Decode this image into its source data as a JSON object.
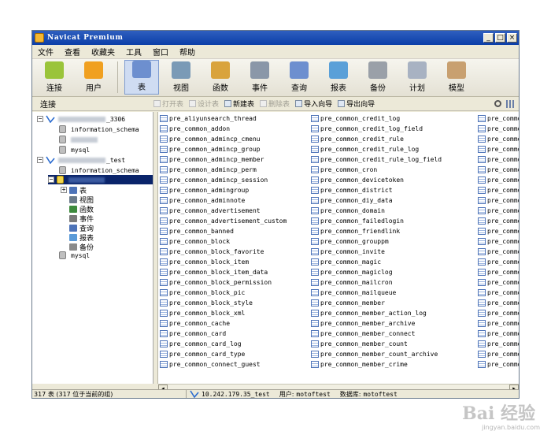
{
  "window": {
    "title": "Navicat Premium",
    "min": "_",
    "max": "□",
    "close": "×"
  },
  "menu": [
    "文件",
    "查看",
    "收藏夹",
    "工具",
    "窗口",
    "帮助"
  ],
  "toolbar": [
    {
      "label": "连接",
      "icon": "plug-icon",
      "color": "#9ac43a"
    },
    {
      "label": "用户",
      "icon": "user-icon",
      "color": "#f0a020"
    },
    {
      "label": "表",
      "icon": "table-icon",
      "color": "#6d8fcf",
      "active": true
    },
    {
      "label": "视图",
      "icon": "view-icon",
      "color": "#7a9ab6"
    },
    {
      "label": "函数",
      "icon": "function-icon",
      "color": "#d9a33c"
    },
    {
      "label": "事件",
      "icon": "event-icon",
      "color": "#8a97a8"
    },
    {
      "label": "查询",
      "icon": "query-icon",
      "color": "#6d8fcf"
    },
    {
      "label": "报表",
      "icon": "report-icon",
      "color": "#5aa0d8"
    },
    {
      "label": "备份",
      "icon": "backup-icon",
      "color": "#9aa0a8"
    },
    {
      "label": "计划",
      "icon": "schedule-icon",
      "color": "#a8b2c2"
    },
    {
      "label": "模型",
      "icon": "model-icon",
      "color": "#c8a070"
    }
  ],
  "subbar": {
    "connection_header": "连接",
    "buttons": [
      {
        "label": "打开表",
        "enabled": false
      },
      {
        "label": "设计表",
        "enabled": false
      },
      {
        "label": "新建表",
        "enabled": true
      },
      {
        "label": "删除表",
        "enabled": false
      },
      {
        "label": "导入向导",
        "enabled": true
      },
      {
        "label": "导出向导",
        "enabled": true
      }
    ]
  },
  "tree": {
    "conn1_suffix": "_3306",
    "conn1_dbs": [
      "information_schema",
      "mysql"
    ],
    "conn2_suffix": "_test",
    "conn2_db": "information_schema",
    "nodes": [
      {
        "label": "表",
        "icon": "tables-node-icon"
      },
      {
        "label": "视图",
        "icon": "views-node-icon"
      },
      {
        "label": "函数",
        "icon": "functions-node-icon"
      },
      {
        "label": "事件",
        "icon": "events-node-icon"
      },
      {
        "label": "查询",
        "icon": "queries-node-icon"
      },
      {
        "label": "报表",
        "icon": "reports-node-icon"
      },
      {
        "label": "备份",
        "icon": "backups-node-icon"
      }
    ],
    "conn2_last_db": "mysql"
  },
  "tables": {
    "col1": [
      "pre_aliyunsearch_thread",
      "pre_common_addon",
      "pre_common_admincp_cmenu",
      "pre_common_admincp_group",
      "pre_common_admincp_member",
      "pre_common_admincp_perm",
      "pre_common_admincp_session",
      "pre_common_admingroup",
      "pre_common_adminnote",
      "pre_common_advertisement",
      "pre_common_advertisement_custom",
      "pre_common_banned",
      "pre_common_block",
      "pre_common_block_favorite",
      "pre_common_block_item",
      "pre_common_block_item_data",
      "pre_common_block_permission",
      "pre_common_block_pic",
      "pre_common_block_style",
      "pre_common_block_xml",
      "pre_common_cache",
      "pre_common_card",
      "pre_common_card_log",
      "pre_common_card_type",
      "pre_common_connect_guest"
    ],
    "col2": [
      "pre_common_credit_log",
      "pre_common_credit_log_field",
      "pre_common_credit_rule",
      "pre_common_credit_rule_log",
      "pre_common_credit_rule_log_field",
      "pre_common_cron",
      "pre_common_devicetoken",
      "pre_common_district",
      "pre_common_diy_data",
      "pre_common_domain",
      "pre_common_failedlogin",
      "pre_common_friendlink",
      "pre_common_grouppm",
      "pre_common_invite",
      "pre_common_magic",
      "pre_common_magiclog",
      "pre_common_mailcron",
      "pre_common_mailqueue",
      "pre_common_member",
      "pre_common_member_action_log",
      "pre_common_member_archive",
      "pre_common_member_connect",
      "pre_common_member_count",
      "pre_common_member_count_archive",
      "pre_common_member_crime"
    ],
    "col3": [
      "pre_common_me",
      "pre_common_me",
      "pre_common_me",
      "pre_common_me",
      "pre_common_me",
      "pre_common_me",
      "pre_common_me",
      "pre_common_me",
      "pre_common_me",
      "pre_common_me",
      "pre_common_me",
      "pre_common_me",
      "pre_common_me",
      "pre_common_me",
      "pre_common_me",
      "pre_common_me",
      "pre_common_me",
      "pre_common_me",
      "pre_common_me",
      "pre_common_me",
      "pre_common_me",
      "pre_common_me",
      "pre_common_me",
      "pre_common_me",
      "pre_common_my"
    ]
  },
  "status": {
    "left": "317 表 (317 位于当前的组)",
    "connection": "10.242.179.35_test",
    "user_label": "用户:",
    "user": "motoftest",
    "db_label": "数据库:",
    "db": "motoftest"
  },
  "watermark": {
    "main": "Bai 经验",
    "sub": "jingyan.baidu.com"
  }
}
